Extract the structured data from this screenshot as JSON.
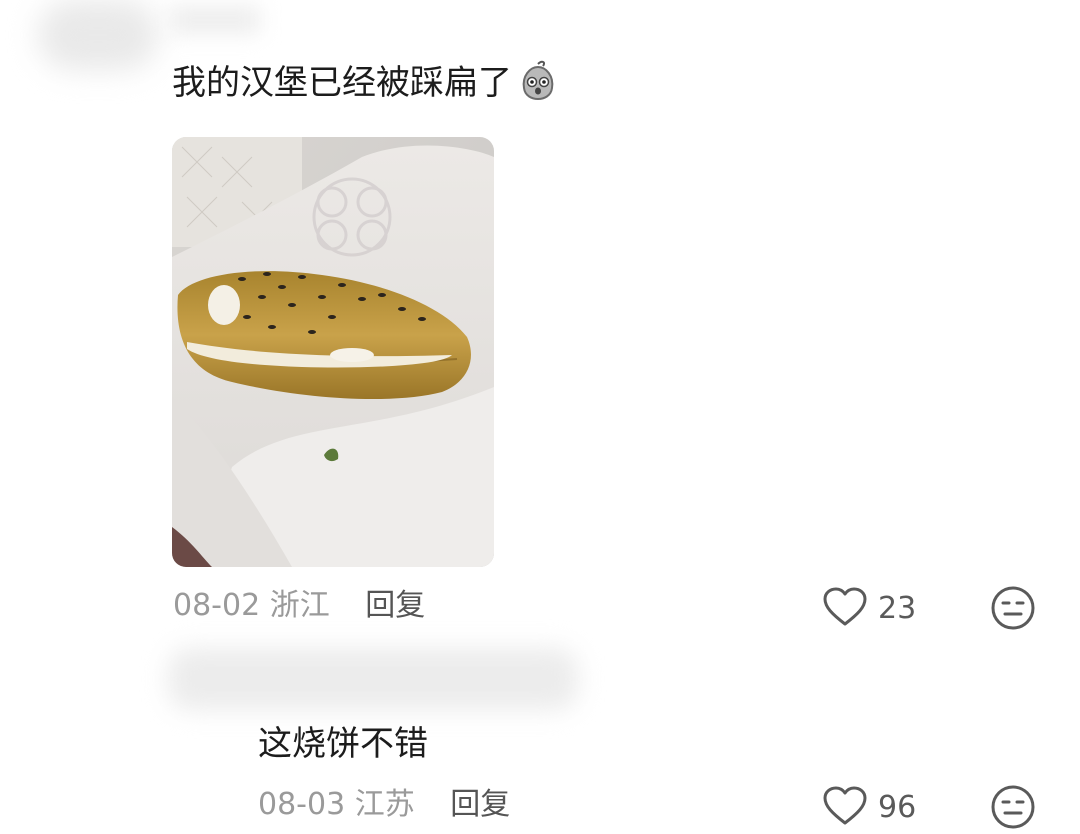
{
  "comments": [
    {
      "text": "我的汉堡已经被踩扁了",
      "emoji": "shocked-sack-emoji",
      "date": "08-02",
      "location": "浙江",
      "reply_label": "回复",
      "likes": "23",
      "has_photo": true,
      "photo": "flattened-burger-photo"
    },
    {
      "text": "这烧饼不错",
      "date": "08-03",
      "location": "江苏",
      "reply_label": "回复",
      "likes": "96"
    }
  ],
  "icons": {
    "like": "heart-icon",
    "dislike": "neutral-face-icon"
  },
  "colors": {
    "text": "#1c1c1c",
    "meta": "#9a9a9a",
    "reply": "#555555",
    "icon": "#5a5a5a"
  }
}
